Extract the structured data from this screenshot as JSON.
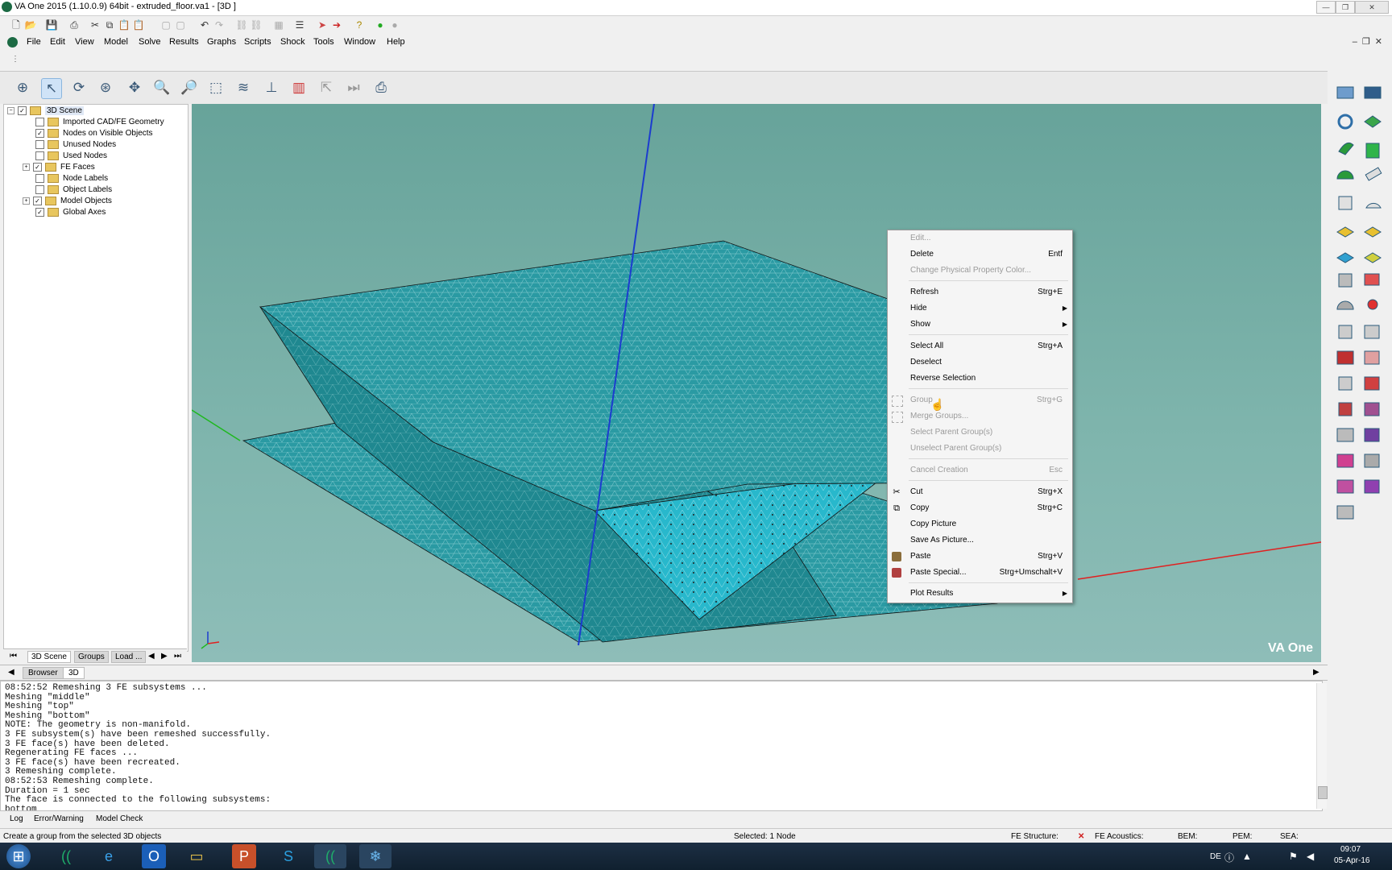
{
  "window": {
    "title": "VA One 2015 (1.10.0.9) 64bit - extruded_floor.va1 - [3D ]"
  },
  "menubar": [
    "File",
    "Edit",
    "View",
    "Model",
    "Solve",
    "Results",
    "Graphs",
    "Scripts",
    "Shock",
    "Tools",
    "Window",
    "Help"
  ],
  "tree": {
    "items": [
      {
        "label": "3D Scene",
        "checked": true,
        "expanded": true
      },
      {
        "label": "Imported CAD/FE Geometry",
        "checked": false
      },
      {
        "label": "Nodes on Visible Objects",
        "checked": true
      },
      {
        "label": "Unused Nodes",
        "checked": false
      },
      {
        "label": "Used Nodes",
        "checked": false
      },
      {
        "label": "FE Faces",
        "checked": true,
        "expandable": true
      },
      {
        "label": "Node Labels",
        "checked": false
      },
      {
        "label": "Object Labels",
        "checked": false
      },
      {
        "label": "Model Objects",
        "checked": true,
        "expandable": true
      },
      {
        "label": "Global Axes",
        "checked": true
      }
    ],
    "tabs": [
      "3D Scene",
      "Groups",
      "Load ..."
    ]
  },
  "view_tabs": [
    "Browser",
    "3D"
  ],
  "viewport": {
    "logo": "VA One"
  },
  "context_menu": {
    "items": [
      {
        "label": "Edit...",
        "shortcut": "",
        "disabled": true
      },
      {
        "label": "Delete",
        "shortcut": "Entf"
      },
      {
        "label": "Change Physical Property Color...",
        "shortcut": "",
        "disabled": true
      },
      {
        "label": "Refresh",
        "shortcut": "Strg+E"
      },
      {
        "label": "Hide",
        "shortcut": "",
        "submenu": true
      },
      {
        "label": "Show",
        "shortcut": "",
        "submenu": true
      },
      {
        "label": "Select All",
        "shortcut": "Strg+A"
      },
      {
        "label": "Deselect",
        "shortcut": ""
      },
      {
        "label": "Reverse Selection",
        "shortcut": ""
      },
      {
        "label": "Group",
        "shortcut": "Strg+G",
        "disabled": true
      },
      {
        "label": "Merge Groups...",
        "shortcut": "",
        "disabled": true
      },
      {
        "label": "Select Parent Group(s)",
        "shortcut": "",
        "disabled": true
      },
      {
        "label": "Unselect Parent Group(s)",
        "shortcut": "",
        "disabled": true
      },
      {
        "label": "Cancel Creation",
        "shortcut": "Esc",
        "disabled": true
      },
      {
        "label": "Cut",
        "shortcut": "Strg+X"
      },
      {
        "label": "Copy",
        "shortcut": "Strg+C"
      },
      {
        "label": "Copy Picture",
        "shortcut": ""
      },
      {
        "label": "Save As Picture...",
        "shortcut": ""
      },
      {
        "label": "Paste",
        "shortcut": "Strg+V"
      },
      {
        "label": "Paste Special...",
        "shortcut": "Strg+Umschalt+V"
      },
      {
        "label": "Plot Results",
        "shortcut": "",
        "submenu": true
      }
    ]
  },
  "log": {
    "text": "08:52:52 Remeshing 3 FE subsystems ...\nMeshing \"middle\"\nMeshing \"top\"\nMeshing \"bottom\"\nNOTE: The geometry is non-manifold.\n3 FE subsystem(s) have been remeshed successfully.\n3 FE face(s) have been deleted.\nRegenerating FE faces ...\n3 FE face(s) have been recreated.\n3 Remeshing complete.\n08:52:53 Remeshing complete.\nDuration = 1 sec\nThe face is connected to the following subsystems:\nbottom",
    "tabs": [
      "Log",
      "Error/Warning",
      "Model Check"
    ]
  },
  "statusbar": {
    "message": "Create a group from the selected 3D objects",
    "selected": "Selected: 1 Node",
    "fe_structure": "FE Structure:",
    "fe_acoustics": "FE Acoustics:",
    "bem": "BEM:",
    "pem": "PEM:",
    "sea": "SEA:"
  },
  "taskbar": {
    "lang": "DE",
    "time": "09:07",
    "date": "05-Apr-16"
  },
  "colors": {
    "mesh": "#2a9aa3",
    "mesh_highlight": "#28b4c8",
    "axis_z": "#1c3ccf",
    "axis_x": "#e02020",
    "axis_y": "#1fb81f",
    "background": "#6aa59c"
  }
}
